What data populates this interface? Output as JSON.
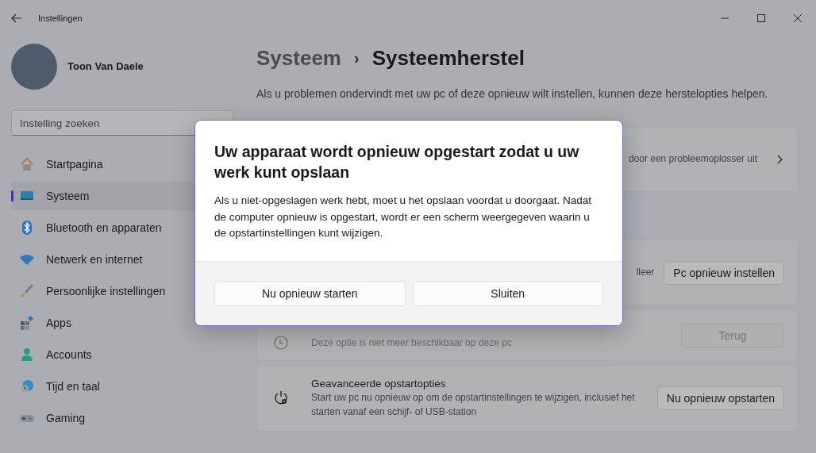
{
  "window": {
    "title": "Instellingen"
  },
  "user": {
    "name": "Toon Van Daele"
  },
  "search": {
    "placeholder": "Instelling zoeken"
  },
  "nav": [
    {
      "label": "Startpagina",
      "selected": false
    },
    {
      "label": "Systeem",
      "selected": true
    },
    {
      "label": "Bluetooth en apparaten",
      "selected": false
    },
    {
      "label": "Netwerk en internet",
      "selected": false
    },
    {
      "label": "Persoonlijke instellingen",
      "selected": false
    },
    {
      "label": "Apps",
      "selected": false
    },
    {
      "label": "Accounts",
      "selected": false
    },
    {
      "label": "Tijd en taal",
      "selected": false
    },
    {
      "label": "Gaming",
      "selected": false
    }
  ],
  "breadcrumb": {
    "parent": "Systeem",
    "separator": "›",
    "current": "Systeemherstel"
  },
  "intro": "Als u problemen ondervindt met uw pc of deze opnieuw wilt instellen, kunnen deze herstelopties helpen.",
  "cards": [
    {
      "kind": "link",
      "description": "door een probleemoplosser uit"
    },
    {
      "kind": "action",
      "description": "lleer",
      "button": "Pc opnieuw instellen",
      "disabled": false
    },
    {
      "kind": "action",
      "description": "Deze optie is niet meer beschikbaar op deze pc",
      "button": "Terug",
      "disabled": true
    },
    {
      "kind": "action",
      "title": "Geavanceerde opstartopties",
      "description": "Start uw pc nu opnieuw op om de opstartinstellingen te wijzigen, inclusief het starten vanaf een schijf- of USB-station",
      "button": "Nu opnieuw opstarten",
      "disabled": false
    }
  ],
  "dialog": {
    "title": "Uw apparaat wordt opnieuw opgestart zodat u uw werk kunt opslaan",
    "body": "Als u niet-opgeslagen werk hebt, moet u het opslaan voordat u doorgaat. Nadat de computer opnieuw is opgestart, wordt er een scherm weergegeven waarin u de opstartinstellingen kunt wijzigen.",
    "buttons": [
      "Nu opnieuw starten",
      "Sluiten"
    ]
  }
}
